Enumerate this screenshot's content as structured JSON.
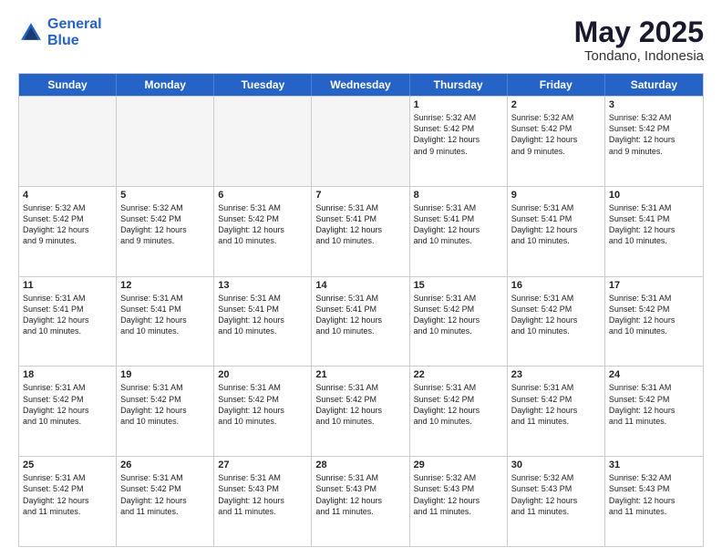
{
  "logo": {
    "line1": "General",
    "line2": "Blue"
  },
  "title": "May 2025",
  "location": "Tondano, Indonesia",
  "header_days": [
    "Sunday",
    "Monday",
    "Tuesday",
    "Wednesday",
    "Thursday",
    "Friday",
    "Saturday"
  ],
  "rows": [
    [
      {
        "day": "",
        "text": "",
        "empty": true
      },
      {
        "day": "",
        "text": "",
        "empty": true
      },
      {
        "day": "",
        "text": "",
        "empty": true
      },
      {
        "day": "",
        "text": "",
        "empty": true
      },
      {
        "day": "1",
        "text": "Sunrise: 5:32 AM\nSunset: 5:42 PM\nDaylight: 12 hours\nand 9 minutes."
      },
      {
        "day": "2",
        "text": "Sunrise: 5:32 AM\nSunset: 5:42 PM\nDaylight: 12 hours\nand 9 minutes."
      },
      {
        "day": "3",
        "text": "Sunrise: 5:32 AM\nSunset: 5:42 PM\nDaylight: 12 hours\nand 9 minutes."
      }
    ],
    [
      {
        "day": "4",
        "text": "Sunrise: 5:32 AM\nSunset: 5:42 PM\nDaylight: 12 hours\nand 9 minutes."
      },
      {
        "day": "5",
        "text": "Sunrise: 5:32 AM\nSunset: 5:42 PM\nDaylight: 12 hours\nand 9 minutes."
      },
      {
        "day": "6",
        "text": "Sunrise: 5:31 AM\nSunset: 5:42 PM\nDaylight: 12 hours\nand 10 minutes."
      },
      {
        "day": "7",
        "text": "Sunrise: 5:31 AM\nSunset: 5:41 PM\nDaylight: 12 hours\nand 10 minutes."
      },
      {
        "day": "8",
        "text": "Sunrise: 5:31 AM\nSunset: 5:41 PM\nDaylight: 12 hours\nand 10 minutes."
      },
      {
        "day": "9",
        "text": "Sunrise: 5:31 AM\nSunset: 5:41 PM\nDaylight: 12 hours\nand 10 minutes."
      },
      {
        "day": "10",
        "text": "Sunrise: 5:31 AM\nSunset: 5:41 PM\nDaylight: 12 hours\nand 10 minutes."
      }
    ],
    [
      {
        "day": "11",
        "text": "Sunrise: 5:31 AM\nSunset: 5:41 PM\nDaylight: 12 hours\nand 10 minutes."
      },
      {
        "day": "12",
        "text": "Sunrise: 5:31 AM\nSunset: 5:41 PM\nDaylight: 12 hours\nand 10 minutes."
      },
      {
        "day": "13",
        "text": "Sunrise: 5:31 AM\nSunset: 5:41 PM\nDaylight: 12 hours\nand 10 minutes."
      },
      {
        "day": "14",
        "text": "Sunrise: 5:31 AM\nSunset: 5:41 PM\nDaylight: 12 hours\nand 10 minutes."
      },
      {
        "day": "15",
        "text": "Sunrise: 5:31 AM\nSunset: 5:42 PM\nDaylight: 12 hours\nand 10 minutes."
      },
      {
        "day": "16",
        "text": "Sunrise: 5:31 AM\nSunset: 5:42 PM\nDaylight: 12 hours\nand 10 minutes."
      },
      {
        "day": "17",
        "text": "Sunrise: 5:31 AM\nSunset: 5:42 PM\nDaylight: 12 hours\nand 10 minutes."
      }
    ],
    [
      {
        "day": "18",
        "text": "Sunrise: 5:31 AM\nSunset: 5:42 PM\nDaylight: 12 hours\nand 10 minutes."
      },
      {
        "day": "19",
        "text": "Sunrise: 5:31 AM\nSunset: 5:42 PM\nDaylight: 12 hours\nand 10 minutes."
      },
      {
        "day": "20",
        "text": "Sunrise: 5:31 AM\nSunset: 5:42 PM\nDaylight: 12 hours\nand 10 minutes."
      },
      {
        "day": "21",
        "text": "Sunrise: 5:31 AM\nSunset: 5:42 PM\nDaylight: 12 hours\nand 10 minutes."
      },
      {
        "day": "22",
        "text": "Sunrise: 5:31 AM\nSunset: 5:42 PM\nDaylight: 12 hours\nand 10 minutes."
      },
      {
        "day": "23",
        "text": "Sunrise: 5:31 AM\nSunset: 5:42 PM\nDaylight: 12 hours\nand 11 minutes."
      },
      {
        "day": "24",
        "text": "Sunrise: 5:31 AM\nSunset: 5:42 PM\nDaylight: 12 hours\nand 11 minutes."
      }
    ],
    [
      {
        "day": "25",
        "text": "Sunrise: 5:31 AM\nSunset: 5:42 PM\nDaylight: 12 hours\nand 11 minutes."
      },
      {
        "day": "26",
        "text": "Sunrise: 5:31 AM\nSunset: 5:42 PM\nDaylight: 12 hours\nand 11 minutes."
      },
      {
        "day": "27",
        "text": "Sunrise: 5:31 AM\nSunset: 5:43 PM\nDaylight: 12 hours\nand 11 minutes."
      },
      {
        "day": "28",
        "text": "Sunrise: 5:31 AM\nSunset: 5:43 PM\nDaylight: 12 hours\nand 11 minutes."
      },
      {
        "day": "29",
        "text": "Sunrise: 5:32 AM\nSunset: 5:43 PM\nDaylight: 12 hours\nand 11 minutes."
      },
      {
        "day": "30",
        "text": "Sunrise: 5:32 AM\nSunset: 5:43 PM\nDaylight: 12 hours\nand 11 minutes."
      },
      {
        "day": "31",
        "text": "Sunrise: 5:32 AM\nSunset: 5:43 PM\nDaylight: 12 hours\nand 11 minutes."
      }
    ]
  ]
}
